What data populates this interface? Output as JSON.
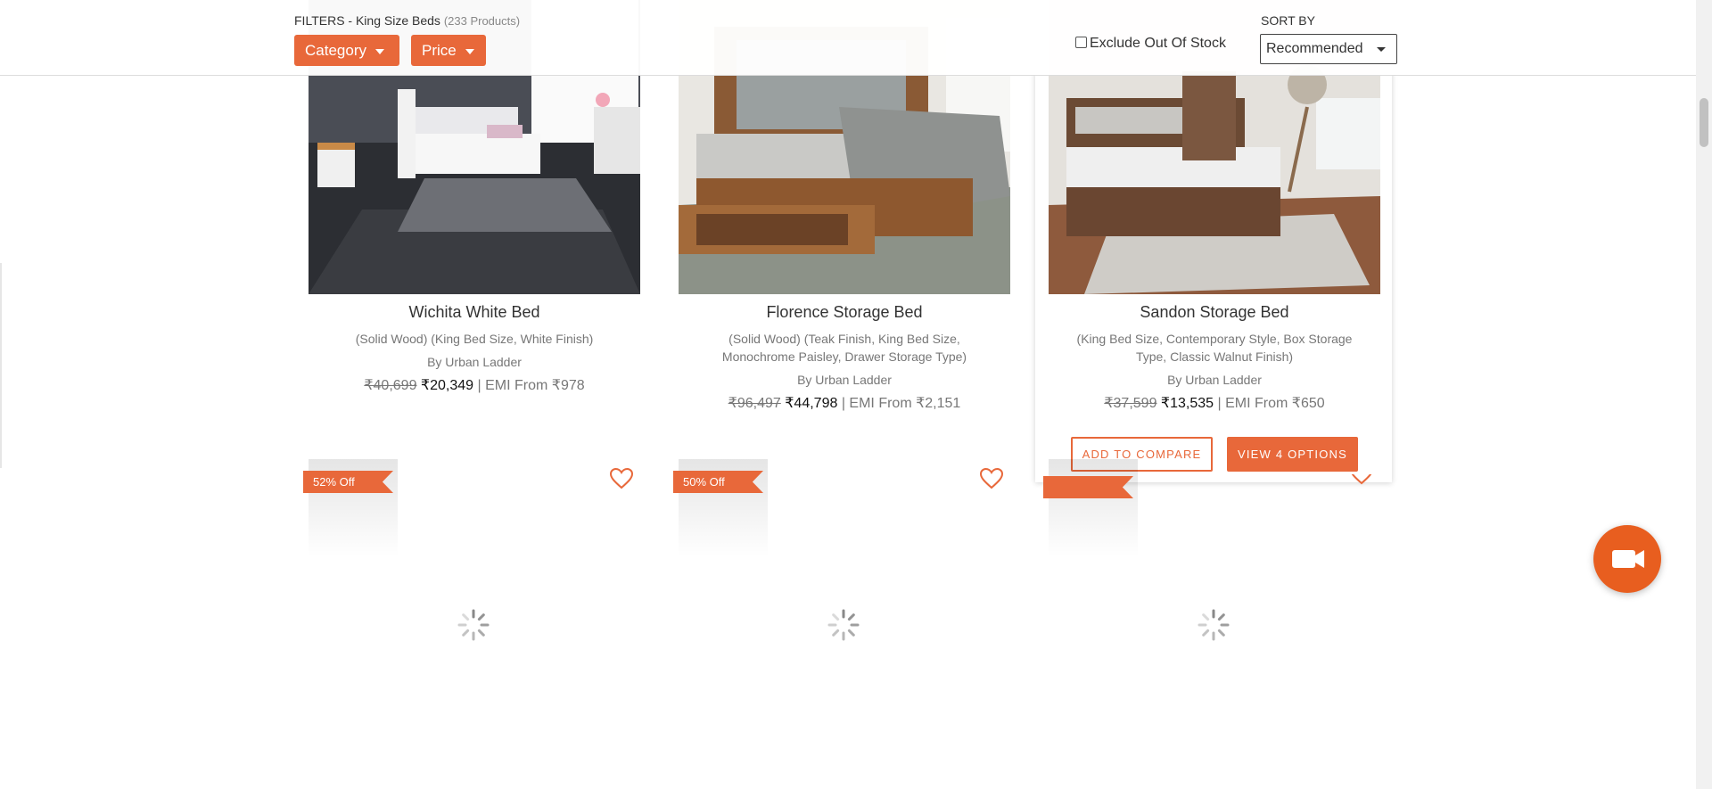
{
  "filters": {
    "label": "FILTERS - King Size Beds",
    "count": "(233 Products)",
    "category_label": "Category",
    "price_label": "Price",
    "exclude_label": "Exclude Out Of Stock",
    "sort_label": "SORT BY",
    "sort_value": "Recommended"
  },
  "products": [
    {
      "name": "Wichita White Bed",
      "desc": "(Solid Wood) (King Bed Size, White Finish)",
      "brand": "By Urban Ladder",
      "mrp": "₹40,699",
      "price": "₹20,349",
      "emi": "| EMI From ₹978"
    },
    {
      "name": "Florence Storage Bed",
      "desc": "(Solid Wood) (Teak Finish, King Bed Size, Monochrome Paisley, Drawer Storage Type)",
      "brand": "By Urban Ladder",
      "mrp": "₹96,497",
      "price": "₹44,798",
      "emi": "| EMI From ₹2,151"
    },
    {
      "name": "Sandon Storage Bed",
      "desc": "(King Bed Size, Contemporary Style, Box Storage Type, Classic Walnut Finish)",
      "brand": "By Urban Ladder",
      "mrp": "₹37,599",
      "price": "₹13,535",
      "emi": "| EMI From ₹650",
      "compare_label": "ADD TO COMPARE",
      "options_label": "VIEW 4 OPTIONS"
    }
  ],
  "next_row": [
    {
      "discount": "52% Off"
    },
    {
      "discount": "50% Off"
    },
    {
      "discount": ""
    }
  ],
  "colors": {
    "accent": "#e8683a",
    "video_button": "#e85e1f"
  },
  "icons": [
    "caret-down-icon",
    "checkbox-icon",
    "heart-icon",
    "loading-spinner-icon",
    "video-camera-icon"
  ]
}
